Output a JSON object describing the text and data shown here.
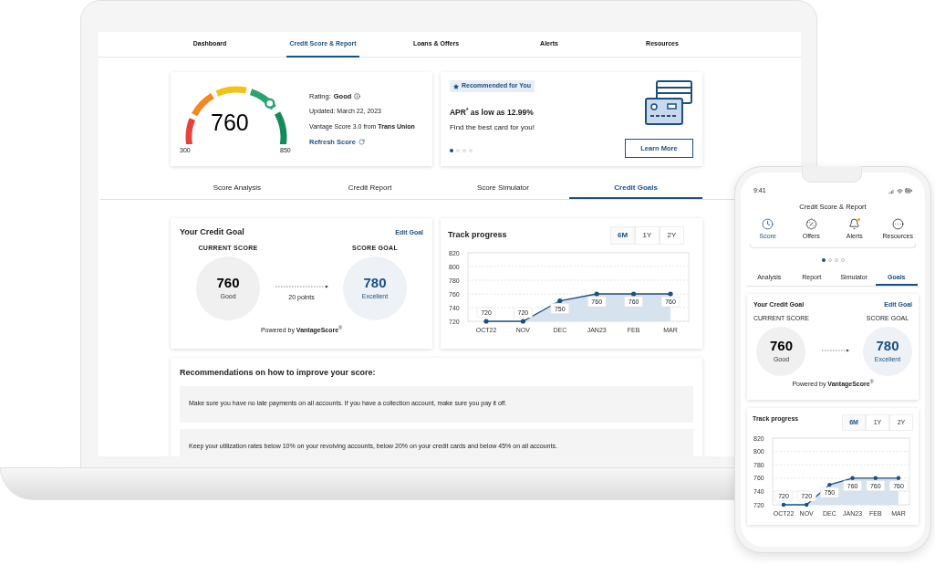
{
  "laptop": {
    "nav": [
      {
        "label": "Dashboard",
        "selected": false
      },
      {
        "label": "Credit Score & Report",
        "selected": true
      },
      {
        "label": "Loans & Offers",
        "selected": false
      },
      {
        "label": "Alerts",
        "selected": false
      },
      {
        "label": "Resources",
        "selected": false
      }
    ],
    "score_card": {
      "score": "760",
      "min": "300",
      "max": "850",
      "rating_label": "Rating:",
      "rating": "Good",
      "updated": "Updated: March 22, 2023",
      "source": "Vantage Score 3.0 from **Trans Union**",
      "refresh": "Refresh Score"
    },
    "promo": {
      "badge": "Recommended for You",
      "headline": "APR$^{*}$ as low as 12.99%",
      "subtitle": "Find the best card for you!",
      "button": "Learn More",
      "dots": [
        {
          "selected": true
        },
        {
          "selected": false
        },
        {
          "selected": false
        },
        {
          "selected": false
        }
      ]
    },
    "tabs": [
      {
        "label": "Score Analysis",
        "selected": false
      },
      {
        "label": "Credit Report",
        "selected": false
      },
      {
        "label": "Score Simulator",
        "selected": false
      },
      {
        "label": "Credit Goals",
        "selected": true
      }
    ],
    "goal": {
      "title": "Your Credit Goal",
      "edit": "Edit Goal",
      "current_label": "CURRENT SCORE",
      "current_score": "760",
      "current_rating": "Good",
      "goal_label": "SCORE GOAL",
      "goal_score": "780",
      "goal_rating": "Excellent",
      "difference": "20 points",
      "powered": "Powered by **VantageScore**$^{®}$"
    },
    "progress": {
      "title": "Track progress",
      "ranges": [
        {
          "label": "6M",
          "selected": true
        },
        {
          "label": "1Y",
          "selected": false
        },
        {
          "label": "2Y",
          "selected": false
        }
      ],
      "chart_data": {
        "type": "line",
        "categories": [
          "OCT22",
          "NOV",
          "DEC",
          "JAN23",
          "FEB",
          "MAR"
        ],
        "series": [
          {
            "color": "#1b4f80",
            "values": [
              720,
              720,
              750,
              760,
              760,
              760
            ]
          }
        ],
        "ylim": [
          720,
          820
        ],
        "yticks": [
          720,
          740,
          760,
          780,
          800,
          820
        ],
        "grid": true,
        "data_labels": true
      }
    },
    "recommendations": {
      "title": "Recommendations on how to improve your score:",
      "items": [
        "Make sure you have no late payments on all accounts. If you have a collection account, make sure you pay it off.",
        "Keep your utilization rates below 10% on your revolving accounts, below 20% on your credit cards and below 45% on all accounts."
      ]
    }
  },
  "phone": {
    "time": "9:41",
    "title": "Credit Score & Report",
    "nav": [
      {
        "label": "Score",
        "selected": true,
        "kind": "clock",
        "alert": false
      },
      {
        "label": "Offers",
        "selected": false,
        "kind": "percent",
        "alert": false
      },
      {
        "label": "Alerts",
        "selected": false,
        "kind": "bell",
        "alert": true
      },
      {
        "label": "Resources",
        "selected": false,
        "kind": "more",
        "alert": false
      }
    ],
    "dots": [
      {
        "selected": true
      },
      {
        "selected": false
      },
      {
        "selected": false
      },
      {
        "selected": false
      }
    ],
    "tabs": [
      {
        "label": "Analysis",
        "selected": false
      },
      {
        "label": "Report",
        "selected": false
      },
      {
        "label": "Simulator",
        "selected": false
      },
      {
        "label": "Goals",
        "selected": true
      }
    ],
    "goal": {
      "title": "Your Credit Goal",
      "edit": "Edit Goal",
      "current_label": "CURRENT SCORE",
      "current_score": "760",
      "current_rating": "Good",
      "goal_label": "SCORE GOAL",
      "goal_score": "780",
      "goal_rating": "Excellent",
      "powered": "Powered by **VantageScore**$^{®}$"
    },
    "progress": {
      "title": "Track progress",
      "ranges": [
        {
          "label": "6M",
          "selected": true
        },
        {
          "label": "1Y",
          "selected": false
        },
        {
          "label": "2Y",
          "selected": false
        }
      ],
      "chart_data": {
        "type": "line",
        "categories": [
          "OCT22",
          "NOV",
          "DEC",
          "JAN23",
          "FEB",
          "MAR"
        ],
        "series": [
          {
            "color": "#1b4f80",
            "values": [
              720,
              720,
              750,
              760,
              760,
              760
            ]
          }
        ],
        "ylim": [
          720,
          820
        ],
        "yticks": [
          720,
          740,
          760,
          780,
          800,
          820
        ],
        "grid": true,
        "data_labels": true
      }
    }
  }
}
